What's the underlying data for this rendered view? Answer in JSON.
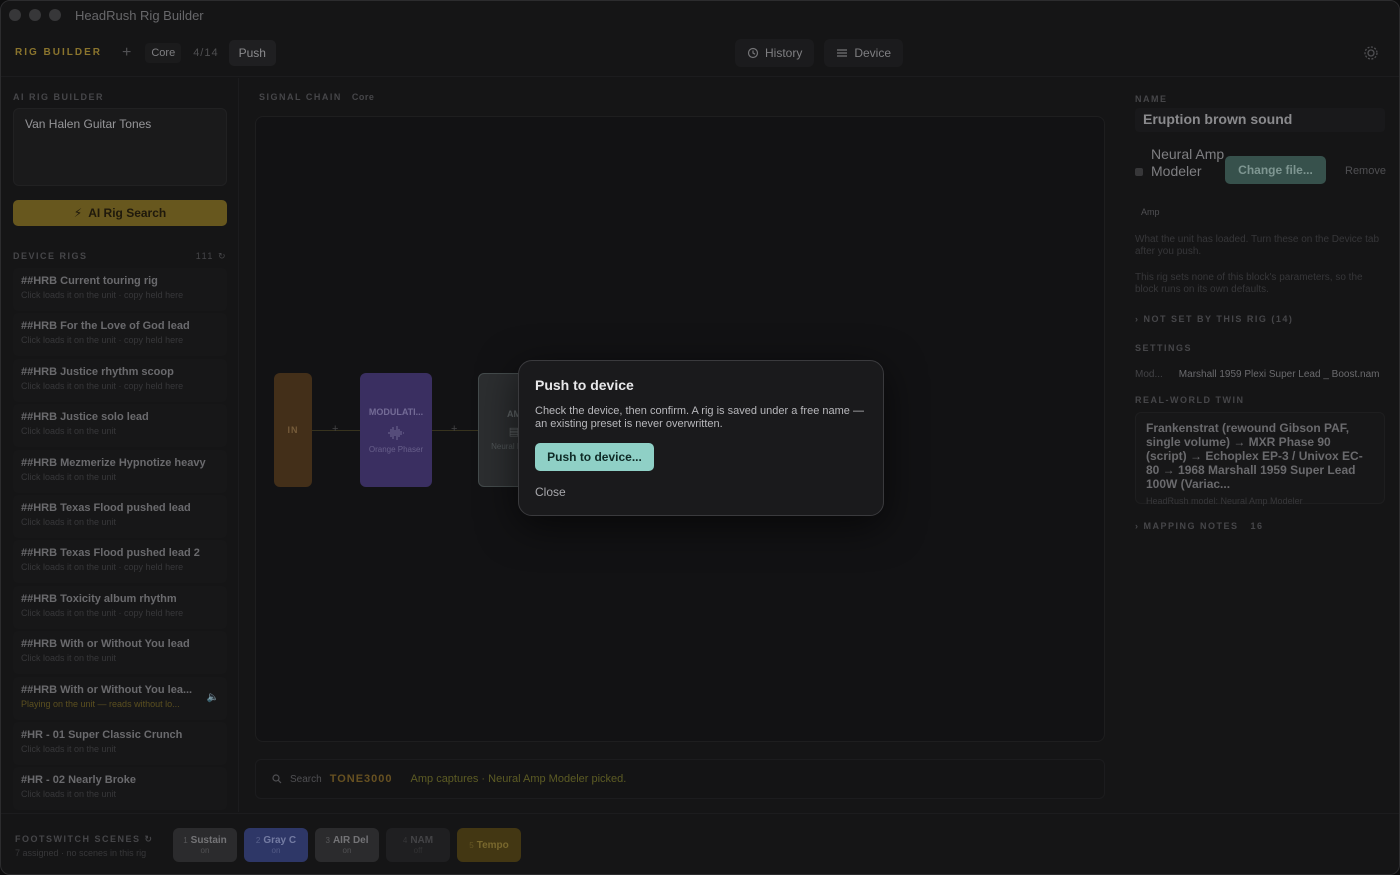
{
  "window": {
    "title": "HeadRush Rig Builder"
  },
  "toolbar": {
    "brand": "RIG BUILDER",
    "add": "+",
    "rig_name": "Core",
    "count": "4/14",
    "push": "Push",
    "history": "History",
    "device": "Device"
  },
  "left": {
    "ai_label": "AI RIG BUILDER",
    "ai_query": "Van Halen Guitar Tones",
    "ai_button": "AI Rig Search",
    "device_rigs_label": "DEVICE RIGS",
    "device_rigs_count": "111",
    "rigs": [
      {
        "title": "##HRB Current touring rig",
        "sub": "Click loads it on the unit · copy held here"
      },
      {
        "title": "##HRB For the Love of God lead",
        "sub": "Click loads it on the unit · copy held here"
      },
      {
        "title": "##HRB Justice rhythm scoop",
        "sub": "Click loads it on the unit · copy held here"
      },
      {
        "title": "##HRB Justice solo lead",
        "sub": "Click loads it on the unit"
      },
      {
        "title": "##HRB Mezmerize Hypnotize heavy",
        "sub": "Click loads it on the unit"
      },
      {
        "title": "##HRB Texas Flood pushed lead",
        "sub": "Click loads it on the unit"
      },
      {
        "title": "##HRB Texas Flood pushed lead 2",
        "sub": "Click loads it on the unit · copy held here"
      },
      {
        "title": "##HRB Toxicity album rhythm",
        "sub": "Click loads it on the unit · copy held here"
      },
      {
        "title": "##HRB With or Without You lead",
        "sub": "Click loads it on the unit"
      },
      {
        "title": "##HRB With or Without You lea...",
        "sub": "Playing on the unit — reads without lo..."
      },
      {
        "title": "#HR - 01 Super Classic Crunch",
        "sub": "Click loads it on the unit"
      },
      {
        "title": "#HR - 02 Nearly Broke",
        "sub": "Click loads it on the unit"
      }
    ]
  },
  "center": {
    "chain_label": "SIGNAL CHAIN",
    "chain_name": "Core",
    "blocks": {
      "in": "IN",
      "mod_title": "MODULATI...",
      "mod_name": "Orange Phaser",
      "amp_title": "AM",
      "amp_name": "Neural Mode"
    },
    "search_label": "Search",
    "search_brand": "TONE3000",
    "search_msg": "Amp captures · Neural Amp Modeler picked."
  },
  "right": {
    "name_label": "NAME",
    "name_value": "Eruption brown sound",
    "model_name": "Neural Amp Modeler",
    "change_file": "Change file...",
    "remove": "Remove",
    "amp_tag": "Amp",
    "hint1": "What the unit has loaded. Turn these on the Device tab after you push.",
    "hint2": "This rig sets none of this block's parameters, so the block runs on its own defaults.",
    "not_set": "NOT SET BY THIS RIG (14)",
    "settings_label": "SETTINGS",
    "setting_key": "Mod...",
    "setting_value": "Marshall 1959 Plexi Super Lead _ Boost.nam",
    "twin_label": "REAL-WORLD TWIN",
    "twin_text": "Frankenstrat (rewound Gibson PAF, single volume) → MXR Phase 90 (script) → Echoplex EP-3 / Univox EC-80 → 1968 Marshall 1959 Super Lead 100W (Variac...",
    "twin_sub": "HeadRush model: Neural Amp Modeler",
    "mapping_label": "MAPPING NOTES",
    "mapping_count": "16"
  },
  "footer": {
    "label": "FOOTSWITCH SCENES",
    "sub": "7 assigned · no scenes in this rig",
    "scenes": [
      {
        "num": "1",
        "name": "Sustain",
        "state": "on",
        "color": "#3a3a3c",
        "text": "#9a9a9e"
      },
      {
        "num": "2",
        "name": "Gray C",
        "state": "on",
        "color": "#3e4a8a",
        "text": "#9aa4d8"
      },
      {
        "num": "3",
        "name": "AIR Del",
        "state": "on",
        "color": "#3a3a3c",
        "text": "#9a9a9e"
      },
      {
        "num": "4",
        "name": "NAM",
        "state": "off",
        "color": "#2a2a2c",
        "text": "#5a5a5e"
      },
      {
        "num": "5",
        "name": "Tempo",
        "state": "",
        "color": "#5a4a1a",
        "text": "#a08a3c"
      }
    ]
  },
  "dialog": {
    "title": "Push to device",
    "text": "Check the device, then confirm. A rig is saved under a free name — an existing preset is never overwritten.",
    "button": "Push to device...",
    "close": "Close"
  }
}
